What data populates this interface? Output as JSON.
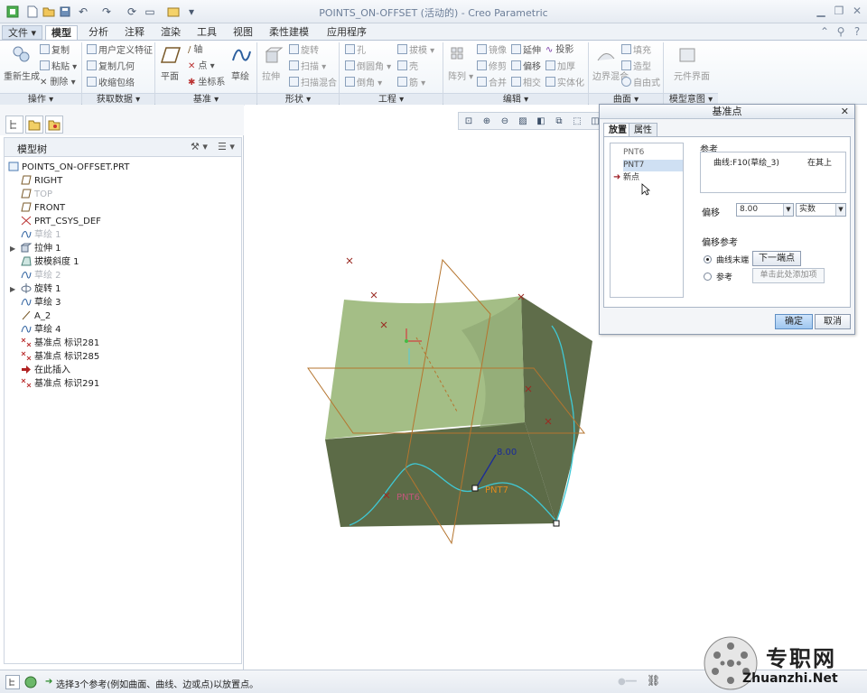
{
  "window": {
    "title": "POINTS_ON-OFFSET (活动的) - Creo Parametric"
  },
  "menu": {
    "tabs": [
      "文件",
      "模型",
      "分析",
      "注释",
      "渲染",
      "工具",
      "视图",
      "柔性建模",
      "应用程序"
    ],
    "active": "模型"
  },
  "ribbon": {
    "operations": {
      "regenerate": "重新生成",
      "copy": "复制",
      "paste": "粘贴",
      "delete": "删除",
      "label": "操作"
    },
    "get_data": {
      "udf": "用户定义特征",
      "copy_geom": "复制几何",
      "shrinkwrap": "收缩包络",
      "label": "获取数据"
    },
    "datum": {
      "plane": "平面",
      "axis": "轴",
      "point": "点",
      "csys": "坐标系",
      "sketch": "草绘",
      "label": "基准"
    },
    "shapes": {
      "extrude": "拉伸",
      "revolve": "旋转",
      "sweep": "扫描",
      "swept_blend": "扫描混合",
      "label": "形状"
    },
    "engineering": {
      "hole": "孔",
      "round": "倒圆角",
      "chamfer": "倒角",
      "draft": "拔模",
      "shell": "壳",
      "rib": "筋",
      "label": "工程"
    },
    "editing": {
      "pattern": "阵列",
      "mirror": "镜像",
      "trim": "修剪",
      "merge": "合并",
      "extend": "延伸",
      "offset": "偏移",
      "intersect": "相交",
      "project": "投影",
      "thicken": "加厚",
      "solidify": "实体化",
      "label": "编辑"
    },
    "surfaces": {
      "boundary_blend": "边界混合",
      "fill": "填充",
      "style": "造型",
      "freestyle": "自由式",
      "label": "曲面"
    },
    "model_intent": {
      "component_interface": "元件界面",
      "label": "模型意图"
    }
  },
  "model_tree": {
    "title": "模型树",
    "items": [
      {
        "label": "POINTS_ON-OFFSET.PRT",
        "icon": "part-icon",
        "dim": false
      },
      {
        "label": "RIGHT",
        "icon": "datum-plane-icon",
        "dim": false
      },
      {
        "label": "TOP",
        "icon": "datum-plane-icon",
        "dim": true
      },
      {
        "label": "FRONT",
        "icon": "datum-plane-icon",
        "dim": false
      },
      {
        "label": "PRT_CSYS_DEF",
        "icon": "csys-icon",
        "dim": false
      },
      {
        "label": "草绘 1",
        "icon": "sketch-icon",
        "dim": true
      },
      {
        "label": "拉伸 1",
        "icon": "extrude-icon",
        "dim": false
      },
      {
        "label": "拔模斜度 1",
        "icon": "draft-icon",
        "dim": false
      },
      {
        "label": "草绘 2",
        "icon": "sketch-icon",
        "dim": true
      },
      {
        "label": "旋转 1",
        "icon": "revolve-icon",
        "dim": false
      },
      {
        "label": "草绘 3",
        "icon": "sketch-icon",
        "dim": false
      },
      {
        "label": "A_2",
        "icon": "axis-icon",
        "dim": false
      },
      {
        "label": "草绘 4",
        "icon": "sketch-icon",
        "dim": false
      },
      {
        "label": "基准点 标识281",
        "icon": "datum-point-icon",
        "dim": false
      },
      {
        "label": "基准点 标识285",
        "icon": "datum-point-icon",
        "dim": false
      },
      {
        "label": "在此插入",
        "icon": "insert-here-icon",
        "dim": false
      },
      {
        "label": "基准点 标识291",
        "icon": "datum-point-icon",
        "dim": false
      }
    ]
  },
  "viewport": {
    "labels": {
      "pnt6": "PNT6",
      "pnt7": "PNT7",
      "offset": "8.00"
    }
  },
  "dialog": {
    "title": "基准点",
    "tabs": [
      "放置",
      "属性"
    ],
    "points": [
      "PNT6",
      "PNT7",
      "新点"
    ],
    "references_label": "参考",
    "reference_item": "曲线:F10(草绘_3)",
    "reference_type": "在其上",
    "offset_label": "偏移",
    "offset_value": "8.00",
    "offset_type": "实数",
    "offset_ref_label": "偏移参考",
    "radio_curve_end": "曲线末端",
    "radio_reference": "参考",
    "next_endpoint": "下一端点",
    "add_item_hint": "单击此处添加项",
    "ok": "确定",
    "cancel": "取消"
  },
  "status": {
    "message": "选择3个参考(例如曲面、曲线、边或点)以放置点。"
  },
  "watermark": {
    "text": "专职网",
    "url": "Zhuanzhi.Net"
  },
  "colors": {
    "solid_light": "#a4be86",
    "solid_dark": "#5c6b47",
    "curve": "#3fc9d6",
    "datum": "#b5752f"
  }
}
